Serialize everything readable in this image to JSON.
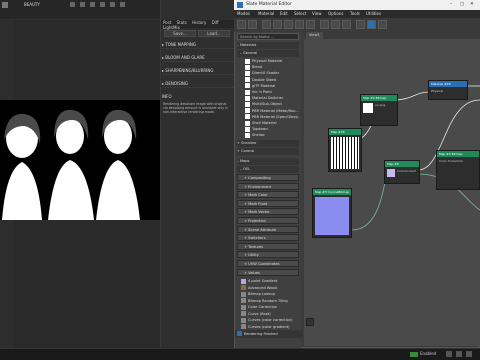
{
  "render_window": {
    "title": "BEAUTY",
    "buttons": {
      "save": "Save...",
      "load": "Load..."
    }
  },
  "render_panel": {
    "tabs": [
      "Post",
      "Stats",
      "History",
      "Diff",
      "LightMix"
    ],
    "sections": [
      "TONE MAPPING",
      "BLOOM AND GLARE",
      "SHARPENING/BLURRING",
      "DENOISING",
      "INFO"
    ],
    "info_text": "Rendering denoised image with original via denoising amount is available only in non-interactive rendering mode."
  },
  "sme": {
    "title": "Slate Material Editor",
    "menu": [
      "Modes",
      "Material",
      "Edit",
      "Select",
      "View",
      "Options",
      "Tools",
      "Utilities"
    ],
    "view_tab": "View1",
    "search_placeholder": "Search by Name ...",
    "browser": {
      "materials_header": "Materials",
      "general_header": "General",
      "materials": [
        "Physical Material",
        "Blend",
        "DirectX Shader",
        "Double Sided",
        "glTF Material",
        "Ink 'n Paint",
        "Material Switcher",
        "Multi/Sub-Object",
        "PBR Material (Metal/Rou...",
        "PBR Material (Spec/Gloss)",
        "Shell Material",
        "Topdown",
        "Shellac"
      ],
      "extra_sections": [
        "Scanline",
        "Corona"
      ],
      "maps_header": "Maps",
      "osl_header": "OSL",
      "osl_groups": [
        "Compositing",
        "Environment",
        "Math Color",
        "Math Float",
        "Math Vector",
        "Projection",
        "Scene Attribute",
        "Switchers",
        "Textures",
        "Utility",
        "UVW Coordinates",
        "Values"
      ],
      "maps": [
        "4 point Gradient",
        "Advanced Wood",
        "Bitmap Lookup",
        "Bitmap Random Tiling",
        "Color Correction",
        "Curve (float)",
        "Curves (color correction)",
        "Curves (color gradient)"
      ]
    },
    "nodes": [
      {
        "id": "n1",
        "label": "Map #0 Bitmap",
        "sub": "ao.png"
      },
      {
        "id": "n2",
        "label": "Map #4 Bitmap",
        "sub": "Color Correction"
      },
      {
        "id": "n3",
        "label": "Map #46",
        "sub": "Bitmap"
      },
      {
        "id": "n4",
        "label": "Map #3 CoronaBitmap",
        "sub": "Normal"
      },
      {
        "id": "n5",
        "label": "Map #8",
        "sub": "ColorCorrect"
      },
      {
        "id": "n6",
        "label": "Material #28",
        "sub": "Physical"
      }
    ],
    "status": "Rendering finished",
    "zoom_label": "100%"
  },
  "statusbar": {
    "mode": "Enabled"
  },
  "colors": {
    "node_green": "#1f8a5a",
    "node_blue": "#2a6fb0",
    "accent": "#4a8fd0"
  }
}
